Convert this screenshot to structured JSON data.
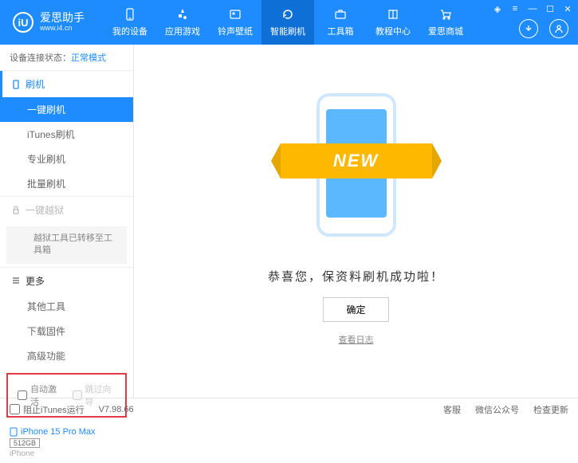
{
  "header": {
    "app_name": "爱思助手",
    "app_url": "www.i4.cn",
    "logo_letter": "iU"
  },
  "nav": {
    "items": [
      {
        "label": "我的设备"
      },
      {
        "label": "应用游戏"
      },
      {
        "label": "铃声壁纸"
      },
      {
        "label": "智能刷机"
      },
      {
        "label": "工具箱"
      },
      {
        "label": "教程中心"
      },
      {
        "label": "爱思商城"
      }
    ]
  },
  "sidebar": {
    "status_prefix": "设备连接状态：",
    "status_mode": "正常模式",
    "section_flash": "刷机",
    "items_flash": [
      "一键刷机",
      "iTunes刷机",
      "专业刷机",
      "批量刷机"
    ],
    "section_jailbreak": "一键越狱",
    "jailbreak_note": "越狱工具已转移至工具箱",
    "section_more": "更多",
    "items_more": [
      "其他工具",
      "下载固件",
      "高级功能"
    ],
    "cb_auto_activate": "自动激活",
    "cb_skip_setup": "跳过向导"
  },
  "device": {
    "name": "iPhone 15 Pro Max",
    "storage": "512GB",
    "type": "iPhone"
  },
  "main": {
    "ribbon": "NEW",
    "success": "恭喜您，保资料刷机成功啦！",
    "ok": "确定",
    "view_log": "查看日志"
  },
  "footer": {
    "block_itunes": "阻止iTunes运行",
    "version": "V7.98.66",
    "support": "客服",
    "wechat": "微信公众号",
    "update": "检查更新"
  }
}
